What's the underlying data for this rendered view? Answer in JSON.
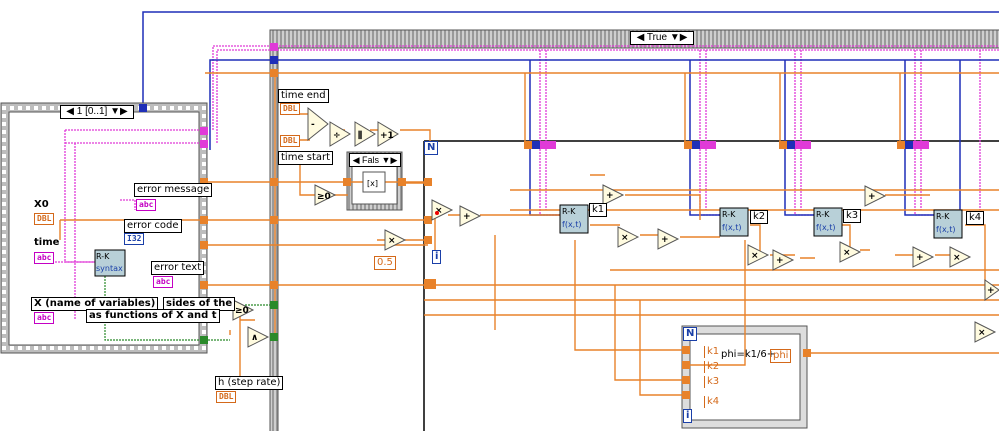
{
  "selectors": {
    "case_true": "True",
    "sequence_frame": "1 [0..1]",
    "case_false": "Fals"
  },
  "labels": {
    "time_end": "time end",
    "time_start": "time start",
    "x0": "X0",
    "time": "time",
    "error_message": "error message",
    "error_code": "error code",
    "error_text": "error text",
    "x_names": "X (name of variables)",
    "sides_of_the": "sides of the",
    "as_functions": "as functions of X and t",
    "h_step_rate": "h (step rate)",
    "k1": "k1",
    "k2": "k2",
    "k3": "k3",
    "k4": "k4",
    "phi_formula": "phi=k1/6+",
    "phi_out": "phi",
    "const_half": "0.5",
    "loop_n": "N",
    "loop_i": "i",
    "rk_title": "R-K",
    "rk_syntax": "syntax",
    "fxt": "f(x,t)"
  },
  "terminals": {
    "dbl": "DBL",
    "abc": "abc",
    "i32": "I32"
  },
  "colors": {
    "orange_wire": "#e8822a",
    "pink_wire": "#e03ad8",
    "blue_wire": "#1f2fb8",
    "green_wire": "#2a8a2a",
    "frame_gray": "#b9b9b9"
  }
}
